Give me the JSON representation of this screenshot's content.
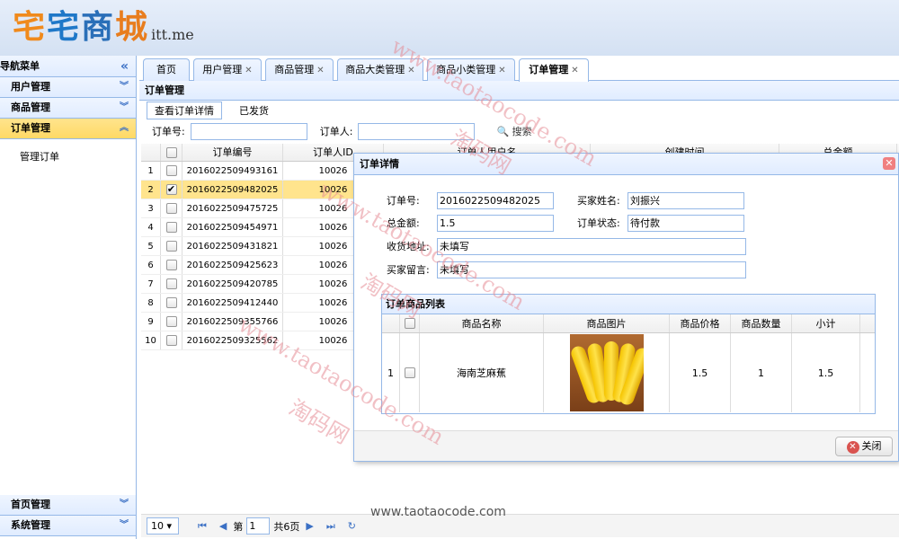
{
  "header": {
    "logo_chars": [
      "宅",
      "宅",
      "商",
      "城"
    ],
    "logo_sub": "itt.me"
  },
  "sidebar": {
    "title": "导航菜单",
    "collapse_icon": "double-chevron-left-icon",
    "items": [
      {
        "label": "用户管理"
      },
      {
        "label": "商品管理"
      },
      {
        "label": "订单管理"
      }
    ],
    "sub_items": [
      {
        "label": "管理订单"
      }
    ],
    "bottom_items": [
      {
        "label": "首页管理"
      },
      {
        "label": "系统管理"
      }
    ]
  },
  "tabs": [
    {
      "label": "首页",
      "closable": false
    },
    {
      "label": "用户管理",
      "closable": true
    },
    {
      "label": "商品管理",
      "closable": true
    },
    {
      "label": "商品大类管理",
      "closable": true
    },
    {
      "label": "商品小类管理",
      "closable": true
    },
    {
      "label": "订单管理",
      "closable": true
    }
  ],
  "panel": {
    "title": "订单管理",
    "toolbar": {
      "view_detail": "查看订单详情",
      "shipped": "已发货"
    },
    "search": {
      "order_no_label": "订单号:",
      "orderer_label": "订单人:",
      "search_label": "搜索"
    }
  },
  "grid": {
    "columns": [
      "订单编号",
      "订单人ID",
      "订单人用户名",
      "创建时间",
      "总金额"
    ],
    "rows": [
      {
        "n": "1",
        "order_no": "2016022509493161",
        "uid": "10026",
        "checked": false
      },
      {
        "n": "2",
        "order_no": "2016022509482025",
        "uid": "10026",
        "checked": true
      },
      {
        "n": "3",
        "order_no": "2016022509475725",
        "uid": "10026",
        "checked": false
      },
      {
        "n": "4",
        "order_no": "2016022509454971",
        "uid": "10026",
        "checked": false
      },
      {
        "n": "5",
        "order_no": "2016022509431821",
        "uid": "10026",
        "checked": false
      },
      {
        "n": "6",
        "order_no": "2016022509425623",
        "uid": "10026",
        "checked": false
      },
      {
        "n": "7",
        "order_no": "2016022509420785",
        "uid": "10026",
        "checked": false
      },
      {
        "n": "8",
        "order_no": "2016022509412440",
        "uid": "10026",
        "checked": false
      },
      {
        "n": "9",
        "order_no": "2016022509355766",
        "uid": "10026",
        "checked": false
      },
      {
        "n": "10",
        "order_no": "2016022509325562",
        "uid": "10026",
        "checked": false
      }
    ]
  },
  "pager": {
    "page_size": "10",
    "page_label": "第",
    "page_value": "1",
    "total_label": "共6页"
  },
  "dialog": {
    "title": "订单详情",
    "fields": {
      "order_no_label": "订单号:",
      "order_no": "2016022509482025",
      "buyer_label": "买家姓名:",
      "buyer": "刘振兴",
      "total_label": "总金额:",
      "total": "1.5",
      "status_label": "订单状态:",
      "status": "待付款",
      "address_label": "收货地址:",
      "address": "未填写",
      "message_label": "买家留言:",
      "message": "未填写"
    },
    "items_title": "订单商品列表",
    "items_columns": [
      "商品名称",
      "商品图片",
      "商品价格",
      "商品数量",
      "小计"
    ],
    "items": [
      {
        "n": "1",
        "name": "海南芝麻蕉",
        "price": "1.5",
        "qty": "1",
        "subtotal": "1.5"
      }
    ],
    "close_label": "关闭"
  },
  "watermarks": [
    "www.taotaocode.com",
    "淘码网"
  ],
  "footer_url": "www.taotaocode.com"
}
